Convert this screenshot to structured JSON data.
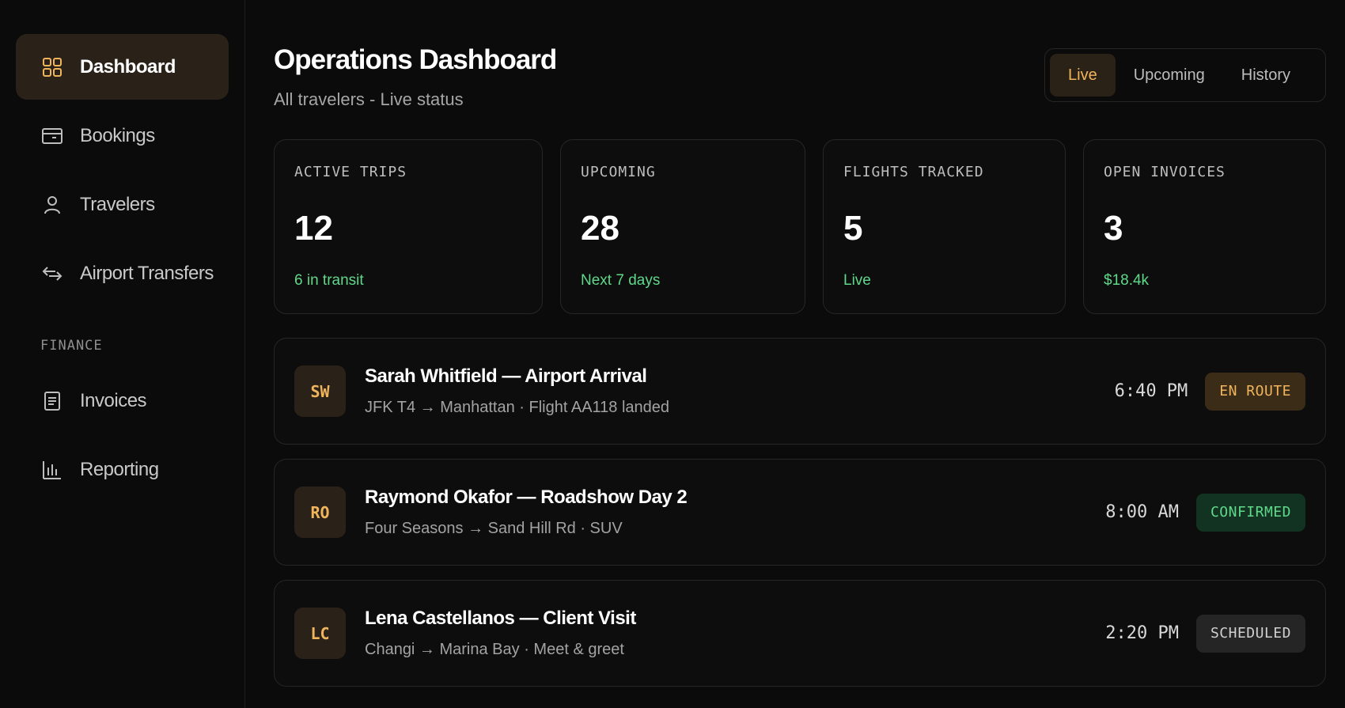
{
  "sidebar": {
    "items": [
      {
        "label": "Dashboard",
        "icon": "grid-icon"
      },
      {
        "label": "Bookings",
        "icon": "card-icon"
      },
      {
        "label": "Travelers",
        "icon": "user-icon"
      },
      {
        "label": "Airport Transfers",
        "icon": "transfer-icon"
      }
    ],
    "finance_label": "FINANCE",
    "finance_items": [
      {
        "label": "Invoices",
        "icon": "document-icon"
      },
      {
        "label": "Reporting",
        "icon": "bar-chart-icon"
      }
    ]
  },
  "header": {
    "title": "Operations Dashboard",
    "subtitle": "All travelers - Live status",
    "tabs": [
      {
        "label": "Live"
      },
      {
        "label": "Upcoming"
      },
      {
        "label": "History"
      }
    ]
  },
  "stats": [
    {
      "label": "ACTIVE TRIPS",
      "value": "12",
      "note": "6 in transit"
    },
    {
      "label": "UPCOMING",
      "value": "28",
      "note": "Next 7 days"
    },
    {
      "label": "FLIGHTS TRACKED",
      "value": "5",
      "note": "Live"
    },
    {
      "label": "OPEN INVOICES",
      "value": "3",
      "note": "$18.4k"
    }
  ],
  "trips": [
    {
      "initials": "SW",
      "title": "Sarah Whitfield — Airport Arrival",
      "subtitle": "JFK T4 → Manhattan · Flight AA118 landed",
      "time": "6:40 PM",
      "status": "EN ROUTE"
    },
    {
      "initials": "RO",
      "title": "Raymond Okafor — Roadshow Day 2",
      "subtitle": "Four Seasons → Sand Hill Rd · SUV",
      "time": "8:00 AM",
      "status": "CONFIRMED"
    },
    {
      "initials": "LC",
      "title": "Lena Castellanos — Client Visit",
      "subtitle": "Changi → Marina Bay · Meet & greet",
      "time": "2:20 PM",
      "status": "SCHEDULED"
    }
  ],
  "colors": {
    "accent": "#f0b45c",
    "success": "#5fd88a",
    "background": "#0b0b0b"
  }
}
